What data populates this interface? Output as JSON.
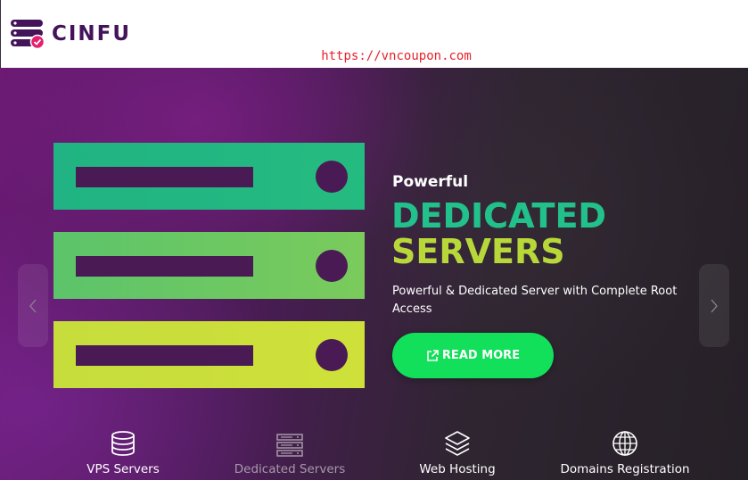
{
  "header": {
    "brand": "CINFU",
    "logo_icon": "server-stack-check-icon",
    "colors": {
      "brand": "#43145a",
      "check": "#e4206e"
    }
  },
  "watermark": "https://vncoupon.com",
  "hero": {
    "kicker": "Powerful",
    "title_line1": "DEDICATED",
    "title_line2": "SERVERS",
    "description": "Powerful & Dedicated Server with Complete Root Access",
    "cta_label": "READ MORE",
    "cta_icon": "external-link-icon",
    "colors": {
      "title1": "#22c08a",
      "title2": "#b8d83a",
      "cta": "#12df5a"
    },
    "illustration": "server-rack-icon",
    "prev_icon": "chevron-left-icon",
    "next_icon": "chevron-right-icon"
  },
  "services": [
    {
      "label": "VPS Servers",
      "icon": "database-icon"
    },
    {
      "label": "Dedicated Servers",
      "icon": "server-icon"
    },
    {
      "label": "Web Hosting",
      "icon": "layers-icon"
    },
    {
      "label": "Domains Registration",
      "icon": "globe-icon"
    }
  ]
}
